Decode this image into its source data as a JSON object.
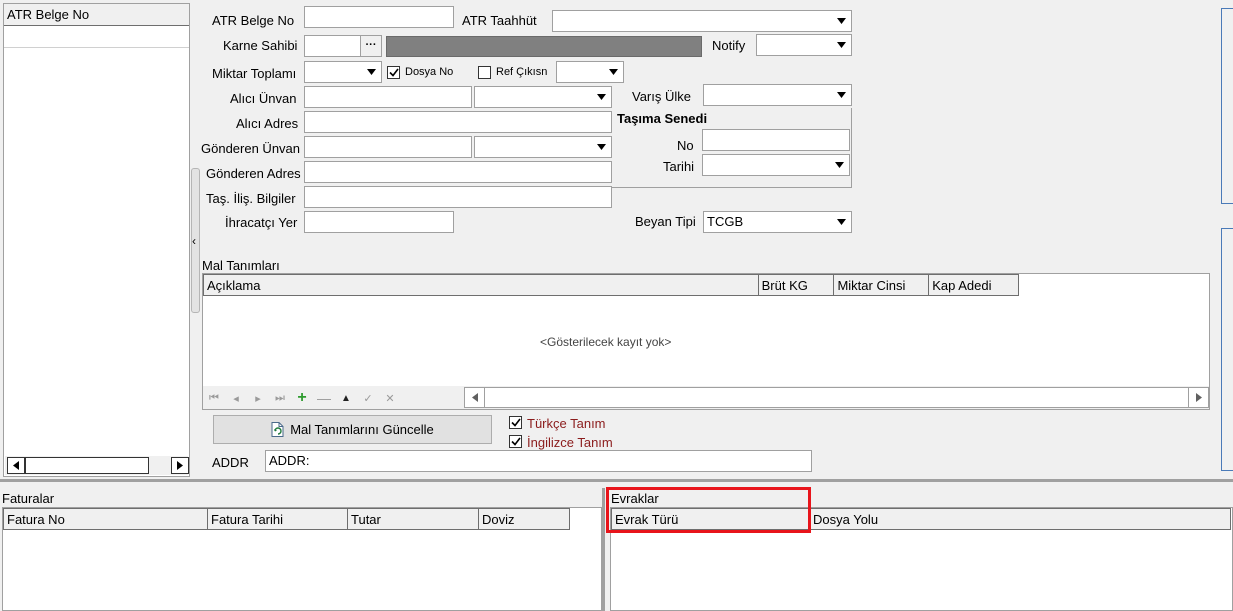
{
  "left_list": {
    "header": "ATR Belge No"
  },
  "form": {
    "atr_belge_no_label": "ATR Belge No",
    "atr_belge_no_value": "",
    "atr_taahhut_label": "ATR Taahhüt",
    "atr_taahhut_value": "",
    "karne_sahibi_label": "Karne Sahibi",
    "karne_sahibi_browse": "···",
    "notify_label": "Notify",
    "miktar_toplami_label": "Miktar Toplamı",
    "dosya_no_label": "Dosya No",
    "dosya_no_checked": true,
    "ref_cikisin_label": "Ref Çıkısn",
    "ref_cikisin_checked": false,
    "alici_unvan_label": "Alıcı Ünvan",
    "varis_ulke_label": "Varış Ülke",
    "alici_adres_label": "Alıcı Adres",
    "tasima_senedi_title": "Taşıma Senedi",
    "tasima_no_label": "No",
    "tasima_tarihi_label": "Tarihi",
    "gonderen_unvan_label": "Gönderen Ünvan",
    "gonderen_adres_label": "Gönderen Adres",
    "tas_ilis_label": "Taş. İliş. Bilgiler",
    "ihracatci_yer_label": "İhracatçı Yer",
    "beyan_tipi_label": "Beyan Tipi",
    "beyan_tipi_value": "TCGB"
  },
  "mal_tanimlari": {
    "title": "Mal Tanımları",
    "columns": [
      "Açıklama",
      "Brüt KG",
      "Miktar Cinsi",
      "Kap Adedi"
    ],
    "empty_text": "<Gösterilecek kayıt yok>",
    "update_button": "Mal Tanımlarını Güncelle",
    "turkce_label": "Türkçe Tanım",
    "turkce_checked": true,
    "ingilizce_label": "İngilizce Tanım",
    "ingilizce_checked": true,
    "addr_label": "ADDR",
    "addr_value": "ADDR:"
  },
  "faturalar": {
    "title": "Faturalar",
    "columns": [
      "Fatura No",
      "Fatura Tarihi",
      "Tutar",
      "Doviz"
    ]
  },
  "evraklar": {
    "title": "Evraklar",
    "columns": [
      "Evrak Türü",
      "Dosya Yolu"
    ]
  },
  "colors": {
    "highlight": "#e8141b",
    "checkbox_label": "#8b1c1c",
    "disabled_field": "#808080",
    "add_icon": "#2e9b2e"
  }
}
